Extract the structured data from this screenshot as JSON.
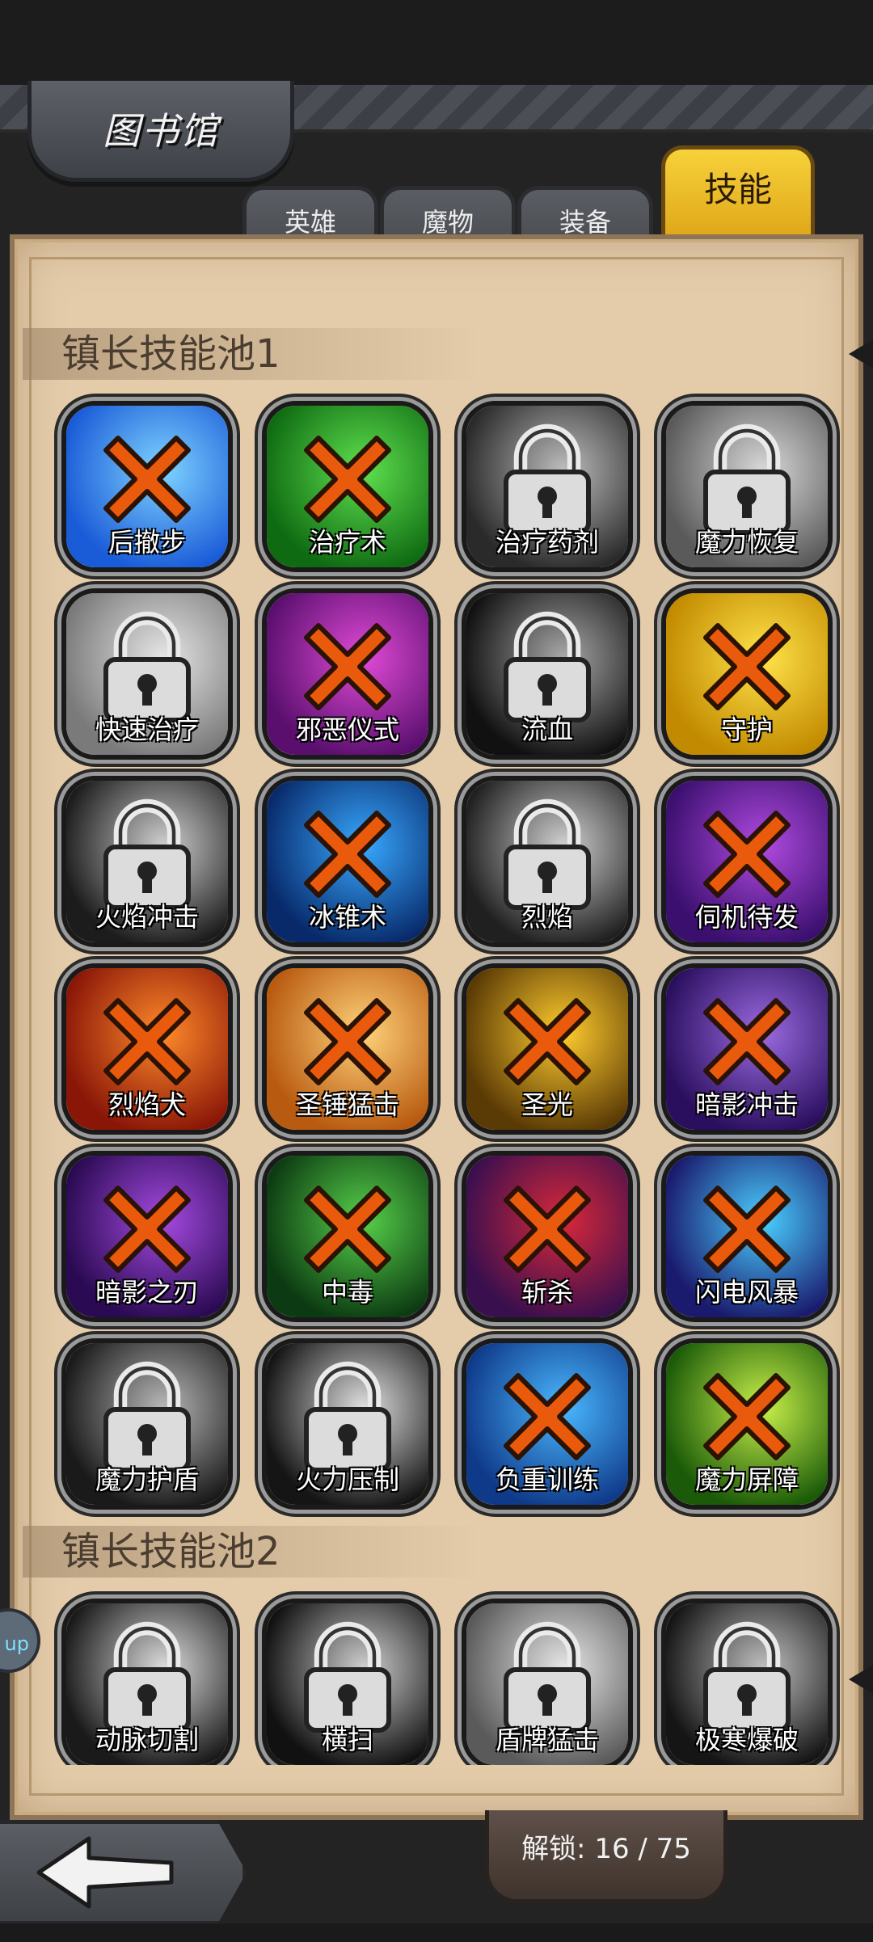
{
  "header": {
    "title": "图书馆"
  },
  "tabs": [
    {
      "label": "英雄",
      "active": false
    },
    {
      "label": "魔物",
      "active": false
    },
    {
      "label": "装备",
      "active": false
    },
    {
      "label": "技能",
      "active": true
    }
  ],
  "sections": [
    {
      "title": "镇长技能池1",
      "skills": [
        {
          "name": "后撤步",
          "status": "crossed",
          "colors": [
            "#1a5bd8",
            "#7fd3ff"
          ]
        },
        {
          "name": "治疗术",
          "status": "crossed",
          "colors": [
            "#0f6b12",
            "#5fe04f"
          ]
        },
        {
          "name": "治疗药剂",
          "status": "locked",
          "colors": [
            "#2a2a2a",
            "#bdbdbd"
          ]
        },
        {
          "name": "魔力恢复",
          "status": "locked",
          "colors": [
            "#5a5a5a",
            "#d9d9d9"
          ]
        },
        {
          "name": "快速治疗",
          "status": "locked",
          "colors": [
            "#7a7a7a",
            "#e6e6e6"
          ]
        },
        {
          "name": "邪恶仪式",
          "status": "crossed",
          "colors": [
            "#5a0f6e",
            "#e04ad6"
          ]
        },
        {
          "name": "流血",
          "status": "locked",
          "colors": [
            "#111111",
            "#a8a8a8"
          ]
        },
        {
          "name": "守护",
          "status": "crossed",
          "colors": [
            "#c28a00",
            "#ffe34a"
          ]
        },
        {
          "name": "火焰冲击",
          "status": "locked",
          "colors": [
            "#1c1c1c",
            "#cfcfcf"
          ]
        },
        {
          "name": "冰锥术",
          "status": "crossed",
          "colors": [
            "#082a6b",
            "#38a8ff"
          ]
        },
        {
          "name": "烈焰",
          "status": "locked",
          "colors": [
            "#202020",
            "#d0d0d0"
          ]
        },
        {
          "name": "伺机待发",
          "status": "crossed",
          "colors": [
            "#3a0f6e",
            "#b04ae0"
          ]
        },
        {
          "name": "烈焰犬",
          "status": "crossed",
          "colors": [
            "#8a1608",
            "#ff8a2a"
          ]
        },
        {
          "name": "圣锤猛击",
          "status": "crossed",
          "colors": [
            "#b85a10",
            "#ffd27a"
          ]
        },
        {
          "name": "圣光",
          "status": "crossed",
          "colors": [
            "#5a3a05",
            "#ffcc2e"
          ]
        },
        {
          "name": "暗影冲击",
          "status": "crossed",
          "colors": [
            "#2a0f5e",
            "#9a6ae0"
          ]
        },
        {
          "name": "暗影之刃",
          "status": "crossed",
          "colors": [
            "#2a0a52",
            "#a44ae0"
          ]
        },
        {
          "name": "中毒",
          "status": "crossed",
          "colors": [
            "#0c3a12",
            "#56d04a"
          ]
        },
        {
          "name": "斩杀",
          "status": "crossed",
          "colors": [
            "#3a0f4e",
            "#d8283a"
          ]
        },
        {
          "name": "闪电风暴",
          "status": "crossed",
          "colors": [
            "#1a1a6e",
            "#4ad0ff"
          ]
        },
        {
          "name": "魔力护盾",
          "status": "locked",
          "colors": [
            "#1a1a1a",
            "#b8b8b8"
          ]
        },
        {
          "name": "火力压制",
          "status": "locked",
          "colors": [
            "#151515",
            "#e0e0e0"
          ]
        },
        {
          "name": "负重训练",
          "status": "crossed",
          "colors": [
            "#0f3a8a",
            "#4ab8ff"
          ]
        },
        {
          "name": "魔力屏障",
          "status": "crossed",
          "colors": [
            "#1a5a08",
            "#c8f04a"
          ]
        }
      ]
    },
    {
      "title": "镇长技能池2",
      "skills": [
        {
          "name": "动脉切割",
          "status": "locked",
          "colors": [
            "#1a1a1a",
            "#dcdcdc"
          ]
        },
        {
          "name": "横扫",
          "status": "locked",
          "colors": [
            "#111111",
            "#cfcfcf"
          ]
        },
        {
          "name": "盾牌猛击",
          "status": "locked",
          "colors": [
            "#5a5a5a",
            "#e6e6e6"
          ]
        },
        {
          "name": "极寒爆破",
          "status": "locked",
          "colors": [
            "#151515",
            "#bfbfbf"
          ]
        }
      ]
    }
  ],
  "footer": {
    "unlock_text": "解锁: 16 / 75"
  }
}
